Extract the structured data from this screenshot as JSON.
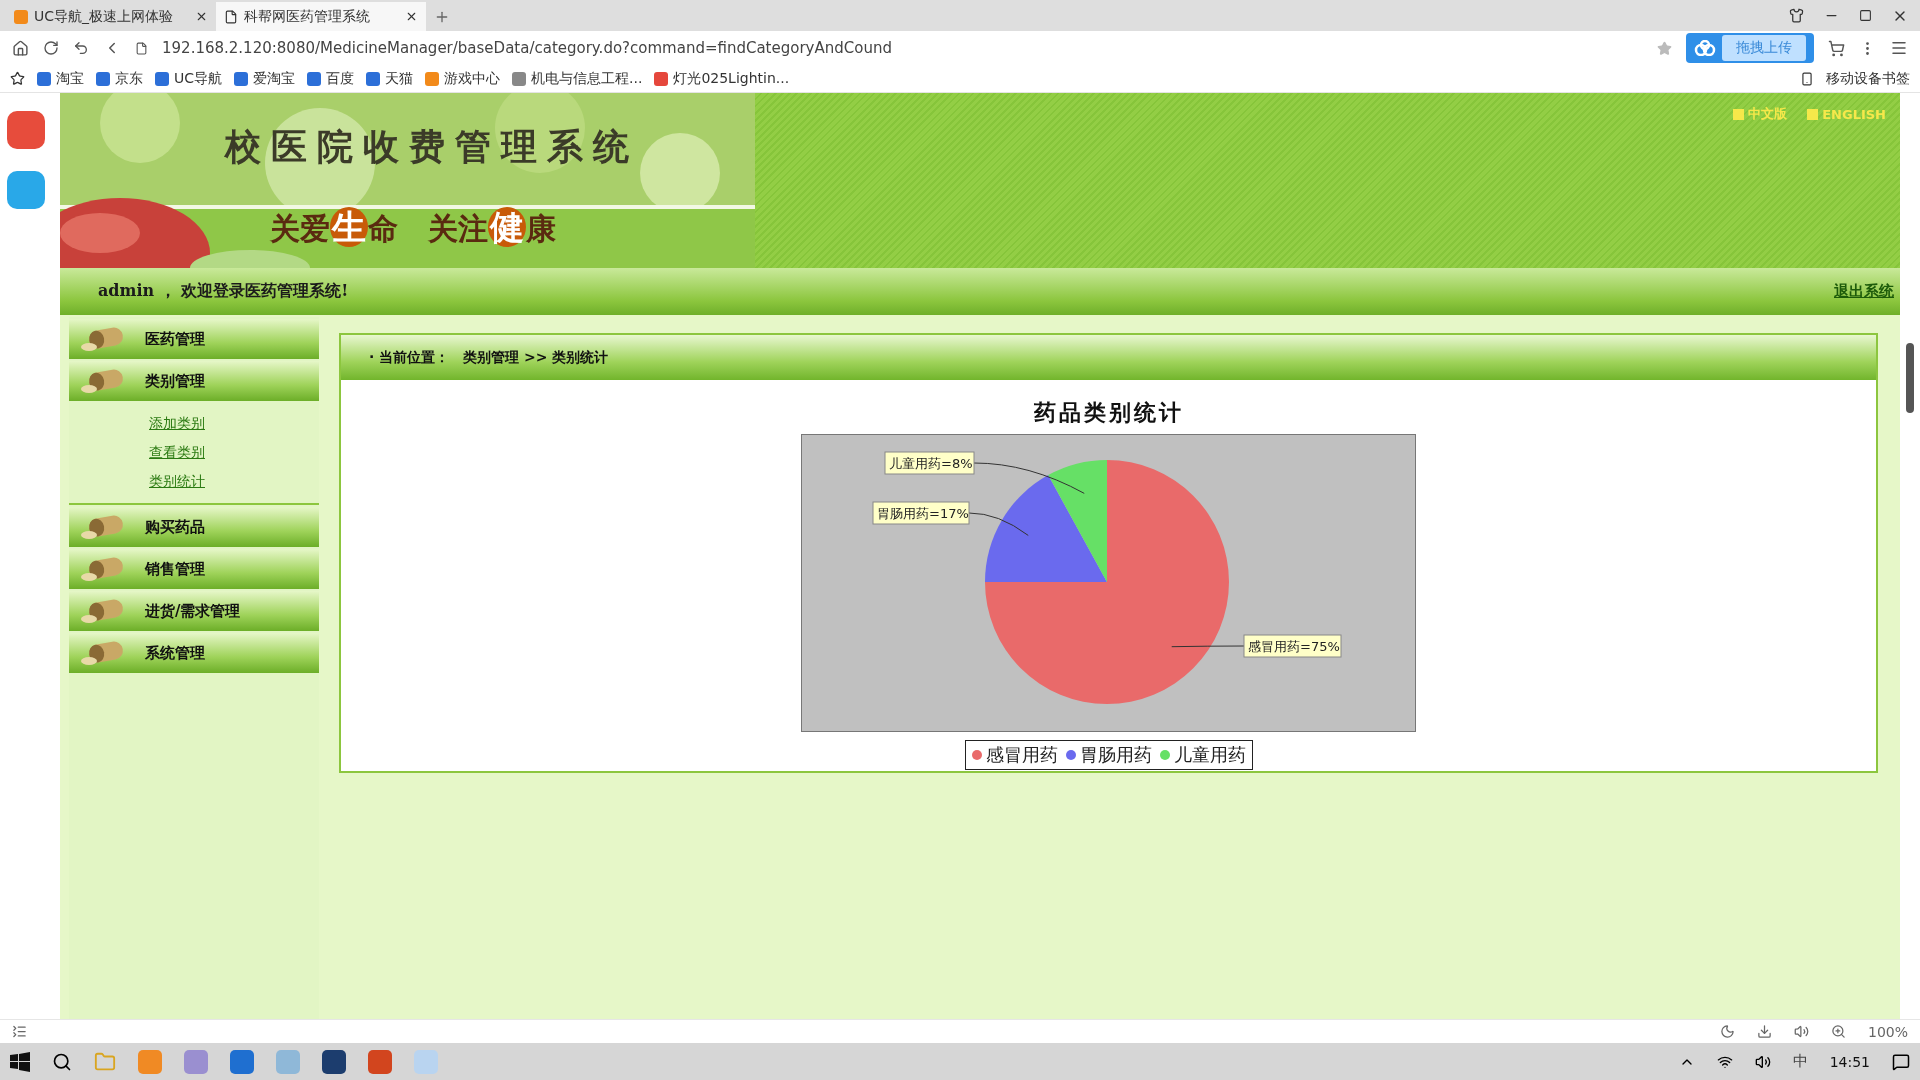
{
  "browser": {
    "tabs": [
      {
        "title": "UC导航_极速上网体验",
        "selected": false
      },
      {
        "title": "科帮网医药管理系统",
        "selected": true
      }
    ],
    "address": "192.168.2.120:8080/MedicineManager/baseData/category.do?command=findCategoryAndCound",
    "upload_button": "拖拽上传",
    "bookmarks": [
      {
        "label": "淘宝",
        "kind": "site"
      },
      {
        "label": "京东",
        "kind": "site"
      },
      {
        "label": "UC导航",
        "kind": "site"
      },
      {
        "label": "爱淘宝",
        "kind": "site"
      },
      {
        "label": "百度",
        "kind": "site"
      },
      {
        "label": "天猫",
        "kind": "site"
      },
      {
        "label": "游戏中心",
        "kind": "game"
      },
      {
        "label": "机电与信息工程...",
        "kind": "page"
      },
      {
        "label": "灯光025Lightin...",
        "kind": "video"
      }
    ],
    "mobile_bookmarks": "移动设备书签",
    "zoom": "100%"
  },
  "header": {
    "title": "校医院收费管理系统",
    "slogan": "关爱**生**命　关注**健**康",
    "languages": [
      "中文版",
      "ENGLISH"
    ]
  },
  "welcome": "admin ， 欢迎登录医药管理系统!",
  "logout": "退出系统",
  "menu": [
    {
      "label": "医药管理"
    },
    {
      "label": "类别管理",
      "children": [
        {
          "label": "添加类别"
        },
        {
          "label": "查看类别"
        },
        {
          "label": "类别统计"
        }
      ]
    },
    {
      "label": "购买药品"
    },
    {
      "label": "销售管理"
    },
    {
      "label": "进货/需求管理"
    },
    {
      "label": "系统管理"
    }
  ],
  "breadcrumb": {
    "label": "· 当前位置：",
    "path": "类别管理 >> 类别统计"
  },
  "chart": {
    "chart_data": {
      "type": "pie",
      "title": "药品类别统计",
      "categories": [
        "感冒用药",
        "胃肠用药",
        "儿童用药"
      ],
      "values": [
        75,
        17,
        8
      ],
      "value_labels": [
        "感冒用药=75%",
        "胃肠用药=17%",
        "儿童用药=8%"
      ]
    },
    "legend": [
      {
        "color": "#e96a6a"
      },
      {
        "color": "#6a6aee"
      },
      {
        "color": "#66e066"
      }
    ]
  },
  "taskbar": {
    "clock": "14:51",
    "ime": "中"
  }
}
